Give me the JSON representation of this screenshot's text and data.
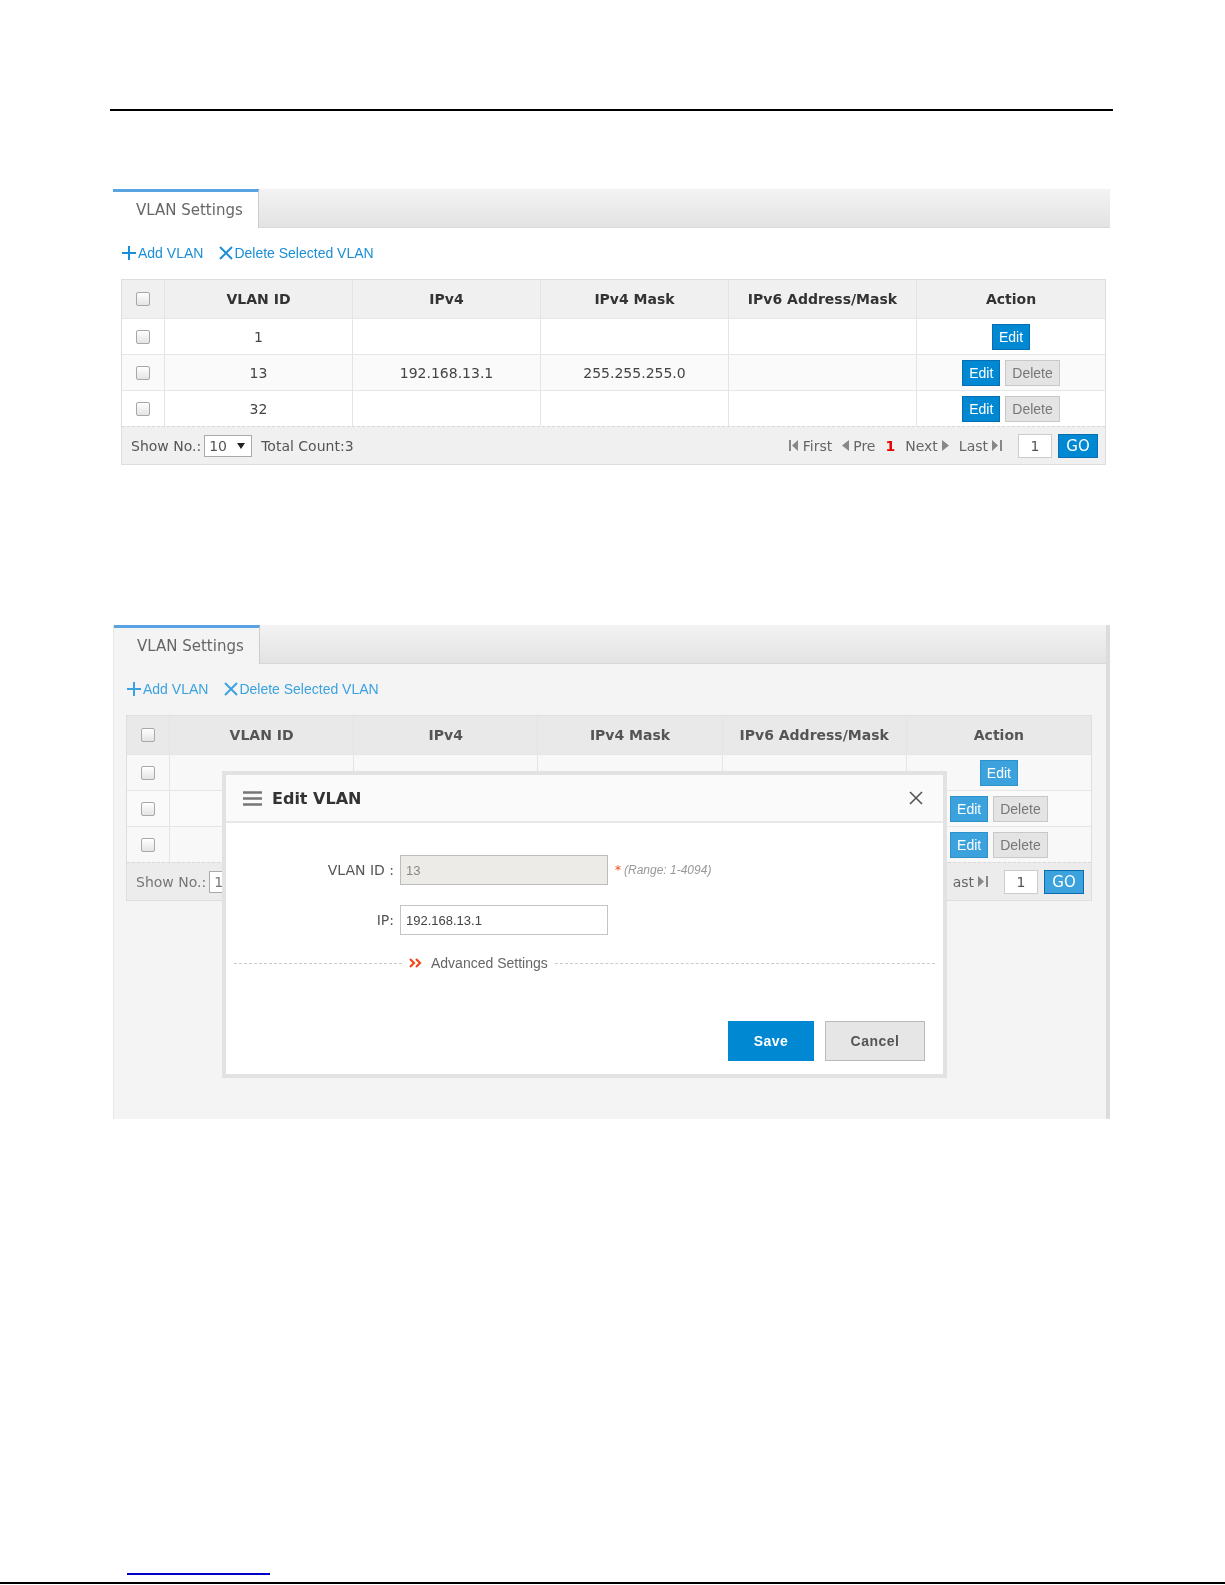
{
  "screens": [
    {
      "tab": {
        "label": "VLAN Settings",
        "selected": true
      },
      "toolbar": [
        {
          "kind": "add",
          "label": "Add VLAN"
        },
        {
          "kind": "delete",
          "label": "Delete Selected VLAN"
        }
      ],
      "table": {
        "columns": [
          "VLAN ID",
          "IPv4",
          "IPv4 Mask",
          "IPv6 Address/Mask",
          "Action"
        ],
        "select_all_checked": false,
        "rows": [
          {
            "checked": false,
            "vlan_id": "1",
            "actions": [
              {
                "kind": "edit",
                "label": "Edit"
              }
            ]
          },
          {
            "checked": false,
            "vlan_id": "13",
            "ipv4": "192.168.13.1",
            "ipv4_mask": "255.255.255.0",
            "actions": [
              {
                "kind": "edit",
                "label": "Edit"
              },
              {
                "kind": "delete",
                "label": "Delete"
              }
            ]
          },
          {
            "checked": false,
            "vlan_id": "32",
            "actions": [
              {
                "kind": "edit",
                "label": "Edit"
              },
              {
                "kind": "delete",
                "label": "Delete"
              }
            ]
          }
        ]
      },
      "footer": {
        "show_label": "Show No.:",
        "show_value": "10",
        "total": "Total Count:3",
        "pager": [
          {
            "kind": "first",
            "label": "First"
          },
          {
            "kind": "prev",
            "label": "Pre"
          },
          {
            "kind": "current",
            "label": "1"
          },
          {
            "kind": "next",
            "label": "Next"
          },
          {
            "kind": "last",
            "label": "Last"
          }
        ],
        "page_input": "1",
        "go": "GO"
      }
    },
    {
      "tab": {
        "label": "VLAN Settings",
        "selected": true
      },
      "toolbar": [
        {
          "kind": "add",
          "label": "Add VLAN"
        },
        {
          "kind": "delete",
          "label": "Delete Selected VLAN"
        }
      ],
      "table": {
        "columns": [
          "VLAN ID",
          "IPv4",
          "IPv4 Mask",
          "IPv6 Address/Mask",
          "Action"
        ],
        "select_all_checked": false,
        "rows": [
          {
            "checked": false,
            "actions": [
              {
                "kind": "edit",
                "label": "Edit"
              }
            ]
          },
          {
            "checked": false,
            "actions": [
              {
                "kind": "edit",
                "label": "Edit"
              },
              {
                "kind": "delete",
                "label": "Delete"
              }
            ]
          },
          {
            "checked": false,
            "actions": [
              {
                "kind": "edit",
                "label": "Edit"
              },
              {
                "kind": "delete",
                "label": "Delete"
              }
            ]
          }
        ]
      },
      "footer": {
        "show_label": "Show No.:",
        "show_value": "1",
        "pager": [
          {
            "kind": "last",
            "label": "ast"
          }
        ],
        "page_input": "1",
        "go": "GO"
      },
      "dialog": {
        "title": "Edit VLAN",
        "fields": [
          {
            "label": "VLAN ID :",
            "value": "13",
            "disabled": true,
            "required_mark": "*",
            "hint": "(Range: 1-4094)"
          },
          {
            "label": "IP:",
            "value": "192.168.13.1",
            "disabled": false
          }
        ],
        "advanced": "Advanced Settings",
        "buttons": [
          {
            "kind": "primary",
            "label": "Save"
          },
          {
            "kind": "secondary",
            "label": "Cancel"
          }
        ]
      }
    }
  ]
}
